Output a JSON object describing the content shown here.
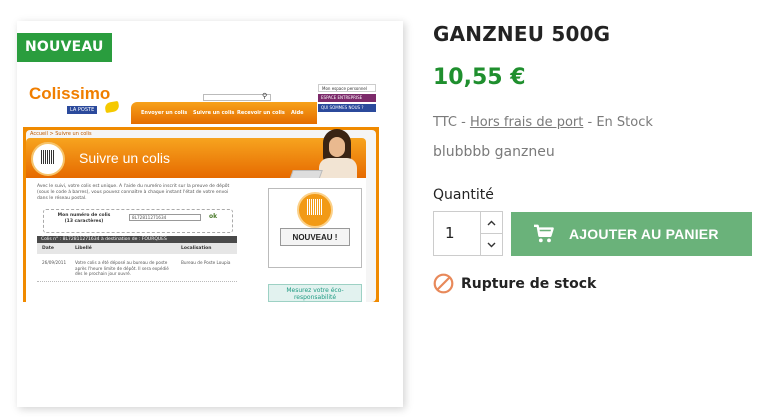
{
  "product": {
    "badge": "NOUVEAU",
    "title": "GANZNEU 500G",
    "price": "10,55 €",
    "tax_prefix": "TTC - ",
    "shipping_link": "Hors frais de port",
    "stock_suffix": " - En Stock",
    "description": "blubbbb ganzneu",
    "quantity_label": "Quantité",
    "quantity_value": "1",
    "add_to_cart_label": "AJOUTER AU PANIER",
    "availability": "Rupture de stock"
  },
  "image_content": {
    "logo": "Colissimo",
    "logo_sub": "LA POSTE",
    "nav_items": [
      "Envoyer un colis",
      "Suivre un colis",
      "Recevoir un colis",
      "Aide"
    ],
    "side_buttons": [
      "Mon espace personnel",
      "ESPACE ENTREPRISE",
      "QUI SOMMES NOUS ?"
    ],
    "breadcrumb": "Accueil > Suivre un colis",
    "page_title": "Suivre un colis",
    "intro_text": "Avec le suivi, votre colis est unique. A l'aide du numéro inscrit sur la preuve de dépôt (sous le code à barres), vous pouvez connaître à chaque instant l'état de votre envoi dans le réseau postal.",
    "form_label": "Mon numéro de colis (13 caractères)",
    "form_value": "8L72811271634",
    "form_ok": "ok",
    "table_header": "Colis n° : 8L72811271634 à destination de : FOURQUES",
    "col_date": "Date",
    "col_libelle": "Libellé",
    "col_localisation": "Localisation",
    "row_date": "26/09/2011",
    "row_libelle": "Votre colis a été déposé au bureau de poste après l'heure limite de dépôt. Il sera expédié dès le prochain jour ouvré.",
    "row_localisation": "Bureau de Poste Loupia",
    "ad_label": "NOUVEAU !",
    "eco_text": "Mesurez votre éco-responsabilité"
  },
  "colors": {
    "badge": "#2a9d3e",
    "price": "#1f8f2e",
    "button": "#6ab27a",
    "ban_icon": "#e8895a"
  }
}
